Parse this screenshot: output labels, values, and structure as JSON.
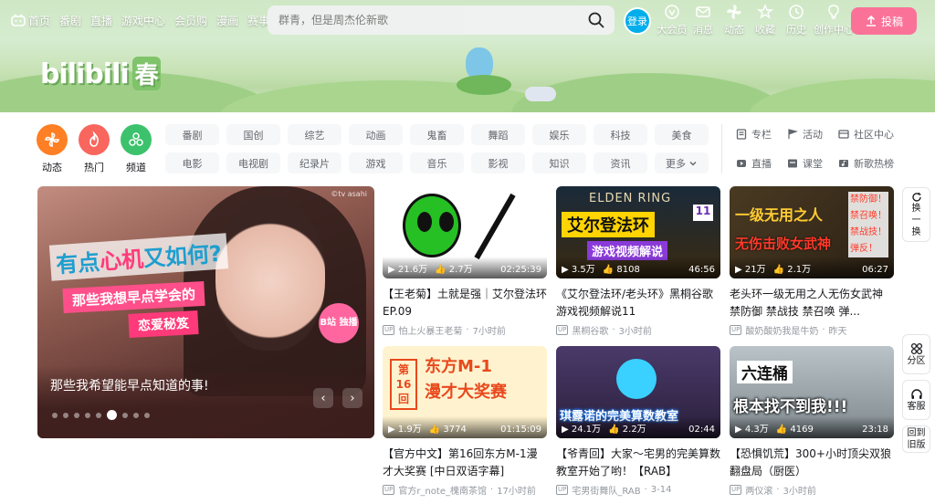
{
  "nav": {
    "home": "首页",
    "items": [
      "番剧",
      "直播",
      "游戏中心",
      "会员购",
      "漫画",
      "赛事"
    ],
    "search_placeholder": "群青，但是周杰伦新歌",
    "login": "登录",
    "right": [
      "大会员",
      "消息",
      "动态",
      "收藏",
      "历史",
      "创作中心"
    ],
    "upload": "投稿"
  },
  "banner": {
    "logo": "bilibili",
    "season": "春"
  },
  "big_channels": [
    {
      "label": "动态",
      "color": "#ff7f24",
      "icon": "dynamic-icon"
    },
    {
      "label": "热门",
      "color": "#f9665e",
      "icon": "fire-icon"
    },
    {
      "label": "频道",
      "color": "#3cc26c",
      "icon": "channel-icon"
    }
  ],
  "tags": [
    "番剧",
    "国创",
    "综艺",
    "动画",
    "鬼畜",
    "舞蹈",
    "娱乐",
    "科技",
    "美食",
    "电影",
    "电视剧",
    "纪录片",
    "游戏",
    "音乐",
    "影视",
    "知识",
    "资讯",
    "更多"
  ],
  "side_links": [
    "专栏",
    "活动",
    "社区中心",
    "直播",
    "课堂",
    "新歌热榜"
  ],
  "carousel": {
    "title": "那些我希望能早点知道的事!",
    "overlay1a": "有点",
    "overlay1b": "心机",
    "overlay1c": "又如何?",
    "overlay2": "那些我想早点学会的",
    "overlay3": "恋爱秘笈",
    "badge": "B站 独播",
    "watermark": "©tv asahi",
    "dot_count": 9,
    "active_dot": 5,
    "prev": "‹",
    "next": "›"
  },
  "videos": [
    {
      "title": "【王老菊】土就是强｜艾尔登法环EP.09",
      "views": "21.6万",
      "likes": "2.7万",
      "duration": "02:25:39",
      "owner": "怕上火暴王老菊",
      "time": "7小时前",
      "thumb": [
        "#ffffff",
        "#26c024"
      ]
    },
    {
      "title": "《艾尔登法环/老头环》黑桐谷歌游戏视频解说11",
      "views": "3.5万",
      "likes": "8108",
      "duration": "46:56",
      "owner": "黑桐谷歌",
      "time": "3小时前",
      "thumb": [
        "#1a2a3a",
        "#ffd400"
      ],
      "thumb_text1": "ELDEN RING",
      "thumb_text2": "艾尔登法环",
      "thumb_text3": "游戏视频解说",
      "thumb_num": "11"
    },
    {
      "title": "老头环一级无用之人无伤女武神 禁防御 禁战技 禁召唤 弹...",
      "views": "21万",
      "likes": "2.1万",
      "duration": "06:27",
      "owner": "酸奶酸奶我是牛奶",
      "time": "昨天",
      "thumb": [
        "#3a2f1d",
        "#ffcc33"
      ],
      "thumb_text1": "一级无用之人",
      "thumb_text2": "无伤击败女武神",
      "thumb_side": [
        "禁防御！",
        "禁召唤！",
        "禁战技！",
        "弹反！"
      ]
    },
    {
      "title": "【官方中文】第16回东方M-1漫才大奖赛 [中日双语字幕]",
      "views": "1.9万",
      "likes": "3774",
      "duration": "01:15:09",
      "owner": "官方r_note_槐南茶馆",
      "time": "17小时前",
      "thumb": [
        "#fff3cf",
        "#e8491d"
      ],
      "thumb_text1": "第16回",
      "thumb_text2": "东方M-1",
      "thumb_text3": "漫才大奖赛"
    },
    {
      "title": "【爷青回】大家～宅男的完美算数教室开始了哟！【RAB】",
      "views": "24.1万",
      "likes": "2.2万",
      "duration": "02:44",
      "owner": "宅男街舞队_RAB",
      "time": "3-14",
      "thumb": [
        "#4a3a6a",
        "#3ad0ff"
      ],
      "thumb_text1": "琪露诺的完美算数教室"
    },
    {
      "title": "【恐惧饥荒】300+小时顶尖双狼翻盘局（厨医）",
      "views": "4.3万",
      "likes": "4169",
      "duration": "23:18",
      "owner": "两仪滚",
      "time": "3小时前",
      "thumb": [
        "#9aa6ad",
        "#ffffff"
      ],
      "thumb_text1": "六连桶",
      "thumb_text2": "根本找不到我!!!"
    }
  ],
  "right_buttons": [
    "换一换",
    "分区",
    "客服",
    "回到旧版"
  ]
}
